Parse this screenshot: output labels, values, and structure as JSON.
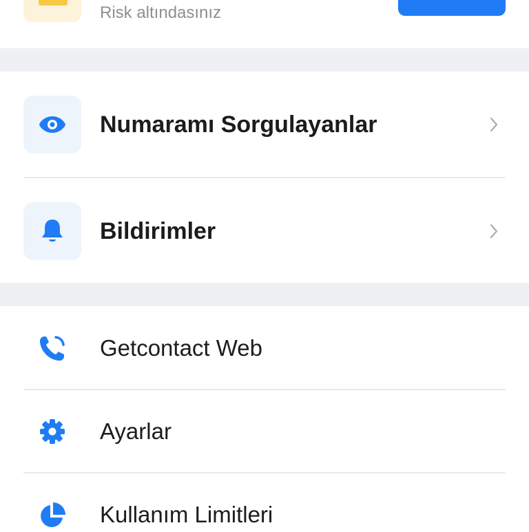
{
  "top": {
    "subtitle": "Risk altındasınız"
  },
  "menu_primary": [
    {
      "label": "Numaramı Sorgulayanlar",
      "icon": "eye-icon"
    },
    {
      "label": "Bildirimler",
      "icon": "bell-icon"
    }
  ],
  "menu_secondary": [
    {
      "label": "Getcontact Web",
      "icon": "phone-icon"
    },
    {
      "label": "Ayarlar",
      "icon": "gear-icon"
    },
    {
      "label": "Kullanım Limitleri",
      "icon": "pie-chart-icon"
    }
  ],
  "colors": {
    "accent": "#1f7cf5",
    "warning": "#f7c844",
    "separator": "#eef0f3"
  }
}
